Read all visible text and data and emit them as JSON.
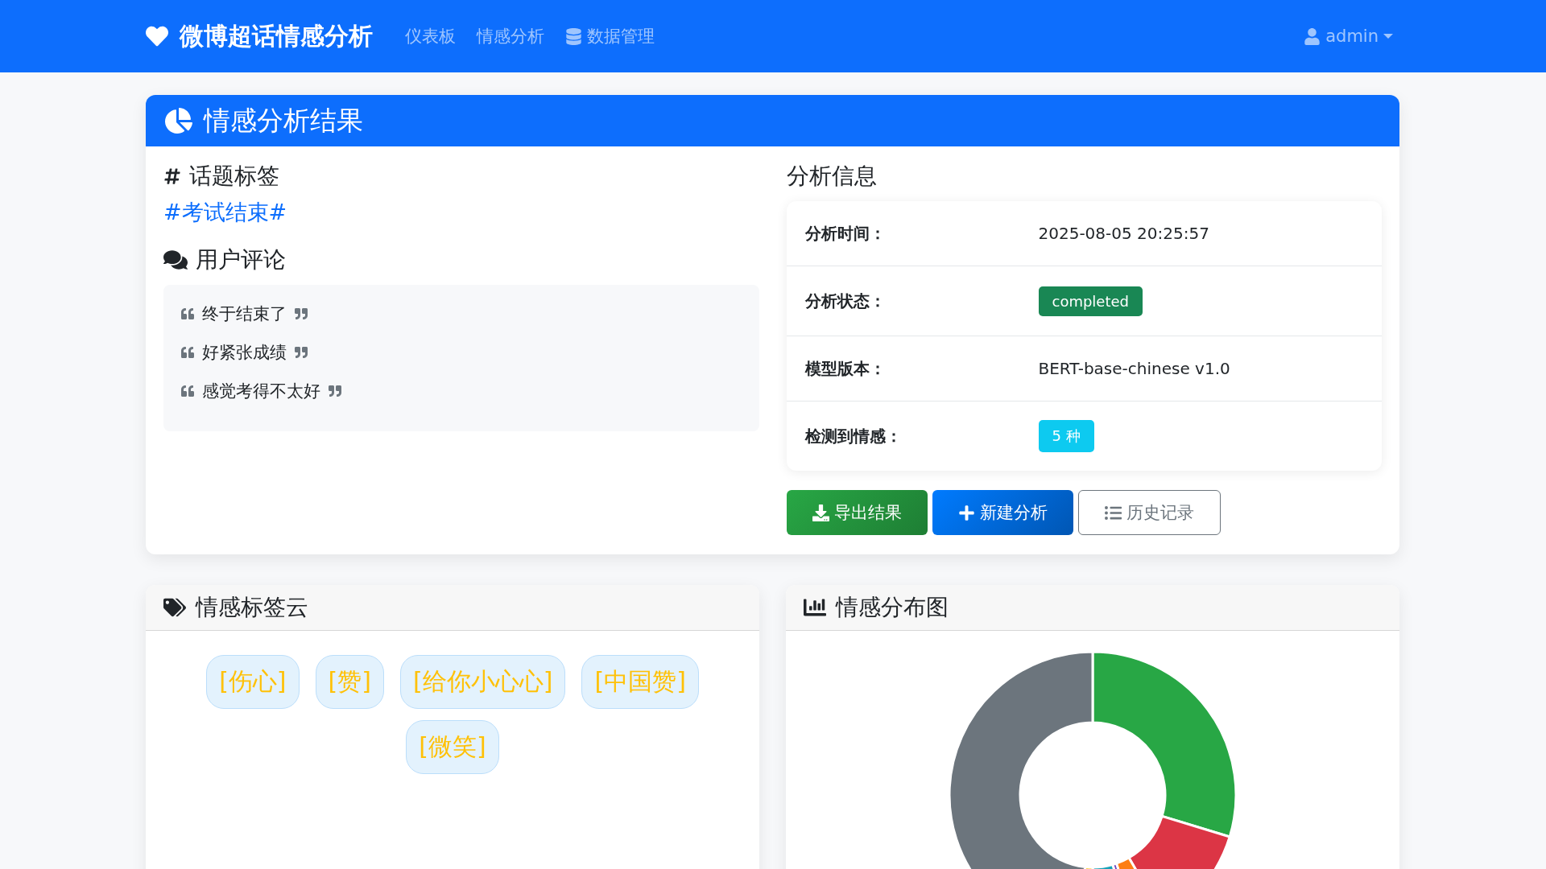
{
  "navbar": {
    "brand": "微博超话情感分析",
    "links": [
      {
        "label": "仪表板",
        "kind": "plain"
      },
      {
        "label": "情感分析",
        "kind": "plain"
      },
      {
        "label": "数据管理",
        "kind": "database"
      }
    ],
    "user": "admin"
  },
  "result": {
    "title": "情感分析结果",
    "topic": {
      "heading": "话题标签",
      "tag": "#考试结束#"
    },
    "comments": {
      "heading": "用户评论",
      "items": [
        "终于结束了",
        "好紧张成绩",
        "感觉考得不太好"
      ]
    },
    "info": {
      "heading": "分析信息",
      "rows": [
        {
          "label": "分析时间：",
          "value": "2025-08-05 20:25:57",
          "kind": "text"
        },
        {
          "label": "分析状态：",
          "value": "completed",
          "kind": "badge",
          "color": "#198754"
        },
        {
          "label": "模型版本：",
          "value": "BERT-base-chinese v1.0",
          "kind": "text"
        },
        {
          "label": "检测到情感：",
          "value": "5 种",
          "kind": "badge",
          "color": "#0dcaf0"
        }
      ]
    },
    "buttons": [
      {
        "label": "导出结果",
        "kind": "export"
      },
      {
        "label": "新建分析",
        "kind": "new"
      },
      {
        "label": "历史记录",
        "kind": "history"
      }
    ]
  },
  "tag_cloud": {
    "heading": "情感标签云",
    "tags": [
      "[伤心]",
      "[赞]",
      "[给你小心心]",
      "[中国赞]",
      "[微笑]"
    ]
  },
  "distribution": {
    "heading": "情感分布图"
  }
}
